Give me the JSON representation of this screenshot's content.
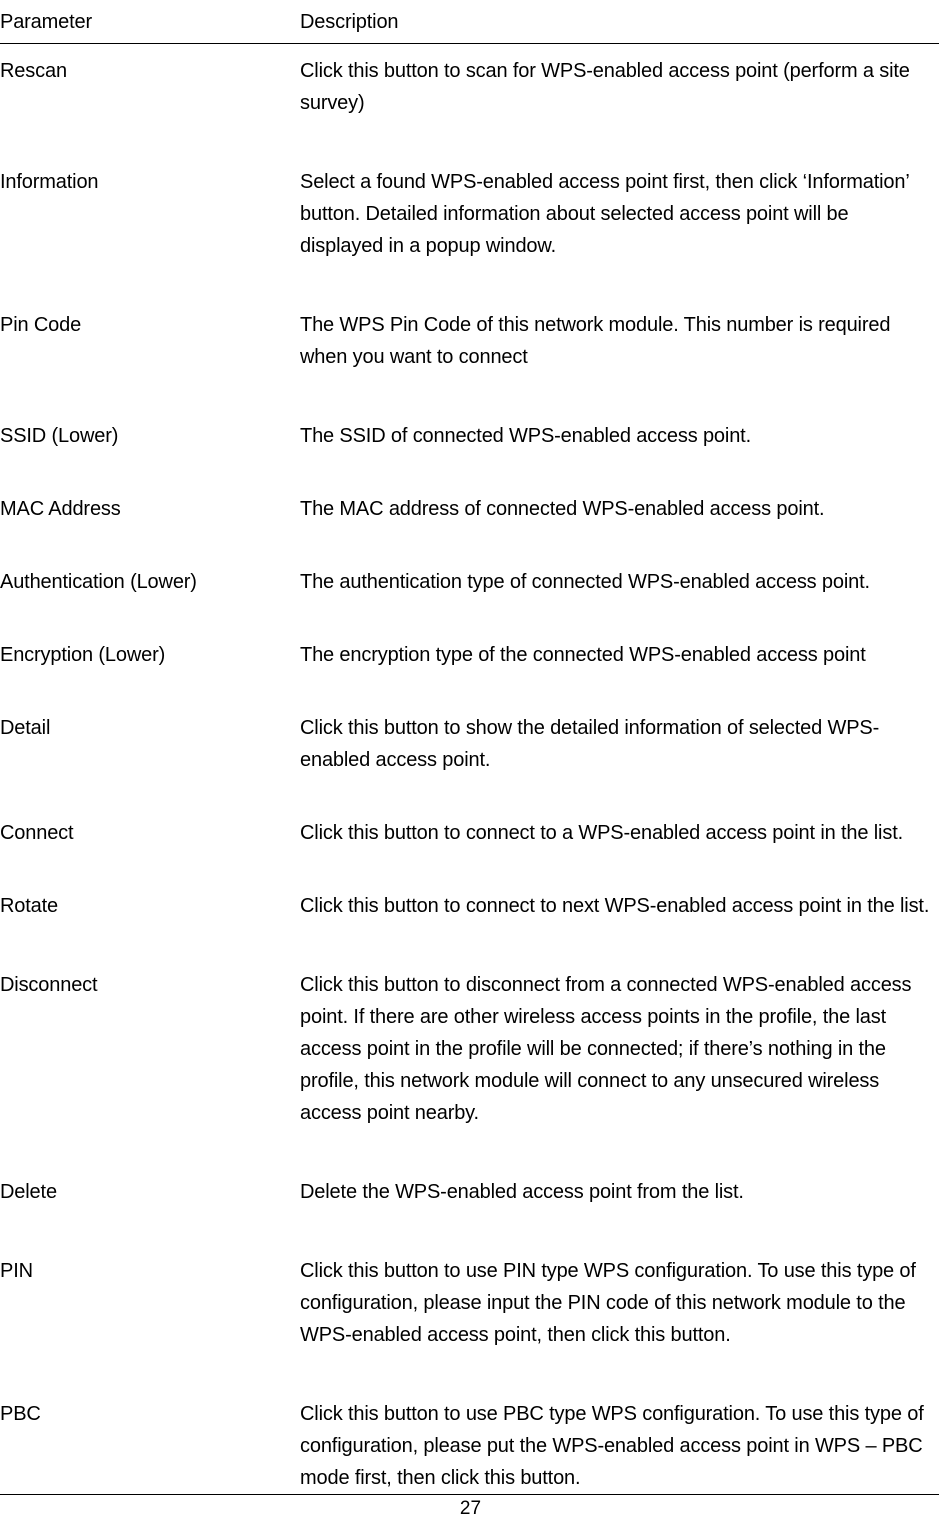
{
  "document": {
    "page_number": "27",
    "table": {
      "headers": {
        "parameter": "Parameter",
        "description": "Description"
      },
      "rows": [
        {
          "parameter": "Rescan",
          "description": "Click this button to scan for WPS-enabled access point (perform a site survey)"
        },
        {
          "parameter": "Information",
          "description": "Select a found WPS-enabled access point first, then click ‘Information’ button. Detailed information about selected access point will be displayed in a popup window."
        },
        {
          "parameter": "Pin Code",
          "description": "The WPS Pin Code of this network module. This number is required when you want to connect"
        },
        {
          "parameter": "SSID (Lower)",
          "description": "The SSID of connected WPS-enabled access point."
        },
        {
          "parameter": "MAC Address",
          "description": "The MAC address of connected WPS-enabled access point."
        },
        {
          "parameter": "Authentication (Lower)",
          "description": "The authentication type of connected WPS-enabled access point."
        },
        {
          "parameter": "Encryption (Lower)",
          "description": "The encryption type of the connected WPS-enabled access point"
        },
        {
          "parameter": "Detail",
          "description": "Click this button to show the detailed information of selected WPS-enabled access point."
        },
        {
          "parameter": "Connect",
          "description": "Click this button to connect to a WPS-enabled access point in the list."
        },
        {
          "parameter": "Rotate",
          "description": "Click this button to connect to next WPS-enabled access point in the list."
        },
        {
          "parameter": "Disconnect",
          "description": "Click this button to disconnect from a connected WPS-enabled access point. If there are other wireless access points in the profile, the last access point in the profile will be connected; if there’s nothing in the profile, this network module will connect to any unsecured wireless access point nearby."
        },
        {
          "parameter": "Delete",
          "description": "Delete the WPS-enabled access point from the list."
        },
        {
          "parameter": "PIN",
          "description": "Click this button to use PIN type WPS configuration. To use this type of configuration, please input the PIN code of this network module to the WPS-enabled access point, then click this button."
        },
        {
          "parameter": "PBC",
          "description": "Click this button to use PBC type WPS configuration. To use this type of configuration, please put the WPS-enabled access point in WPS – PBC mode first, then click this button."
        }
      ]
    }
  }
}
